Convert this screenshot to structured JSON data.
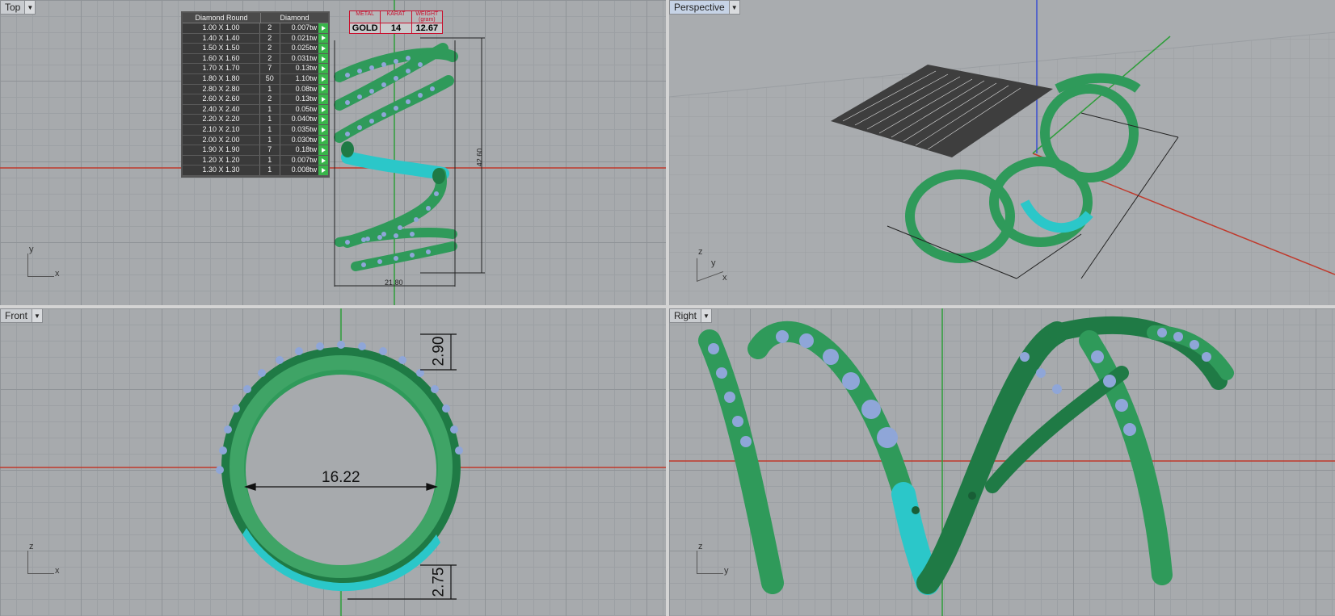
{
  "viewports": {
    "top": {
      "title": "Top",
      "axis_x": "x",
      "axis_y": "y"
    },
    "perspective": {
      "title": "Perspective",
      "axis_x": "x",
      "axis_y": "y",
      "axis_z": "z"
    },
    "front": {
      "title": "Front",
      "axis_x": "x",
      "axis_z": "z"
    },
    "right": {
      "title": "Right",
      "axis_y": "y",
      "axis_z": "z"
    }
  },
  "diamond_table": {
    "header_left": "Diamond Round",
    "header_right": "Diamond",
    "rows": [
      {
        "size": "1.00 X 1.00",
        "qty": "2",
        "wt": "0.007tw"
      },
      {
        "size": "1.40 X 1.40",
        "qty": "2",
        "wt": "0.021tw"
      },
      {
        "size": "1.50 X 1.50",
        "qty": "2",
        "wt": "0.025tw"
      },
      {
        "size": "1.60 X 1.60",
        "qty": "2",
        "wt": "0.031tw"
      },
      {
        "size": "1.70 X 1.70",
        "qty": "7",
        "wt": "0.13tw"
      },
      {
        "size": "1.80 X 1.80",
        "qty": "50",
        "wt": "1.10tw"
      },
      {
        "size": "2.80 X 2.80",
        "qty": "1",
        "wt": "0.08tw"
      },
      {
        "size": "2.60 X 2.60",
        "qty": "2",
        "wt": "0.13tw"
      },
      {
        "size": "2.40 X 2.40",
        "qty": "1",
        "wt": "0.05tw"
      },
      {
        "size": "2.20 X 2.20",
        "qty": "1",
        "wt": "0.040tw"
      },
      {
        "size": "2.10 X 2.10",
        "qty": "1",
        "wt": "0.035tw"
      },
      {
        "size": "2.00 X 2.00",
        "qty": "1",
        "wt": "0.030tw"
      },
      {
        "size": "1.90 X 1.90",
        "qty": "7",
        "wt": "0.18tw"
      },
      {
        "size": "1.20 X 1.20",
        "qty": "1",
        "wt": "0.007tw"
      },
      {
        "size": "1.30 X 1.30",
        "qty": "1",
        "wt": "0.008tw"
      }
    ]
  },
  "metal_table": {
    "h_metal": "METAL",
    "h_karat": "KARAT",
    "h_weight": "WEIGHT (gram)",
    "metal": "GOLD",
    "karat": "14",
    "weight": "12.67"
  },
  "dimensions": {
    "top_width": "21.80",
    "top_height": "42.60",
    "front_inner": "16.22",
    "front_top": "2.90",
    "front_bottom": "2.75"
  },
  "colors": {
    "metal_green": "#2f9a5a",
    "metal_green_dark": "#1f7a45",
    "cyan_part": "#2bc7c9",
    "stone": "#8fa6d8",
    "axis_x": "#c0392b",
    "axis_y": "#2e9e3a",
    "axis_z": "#3a4fd0"
  }
}
